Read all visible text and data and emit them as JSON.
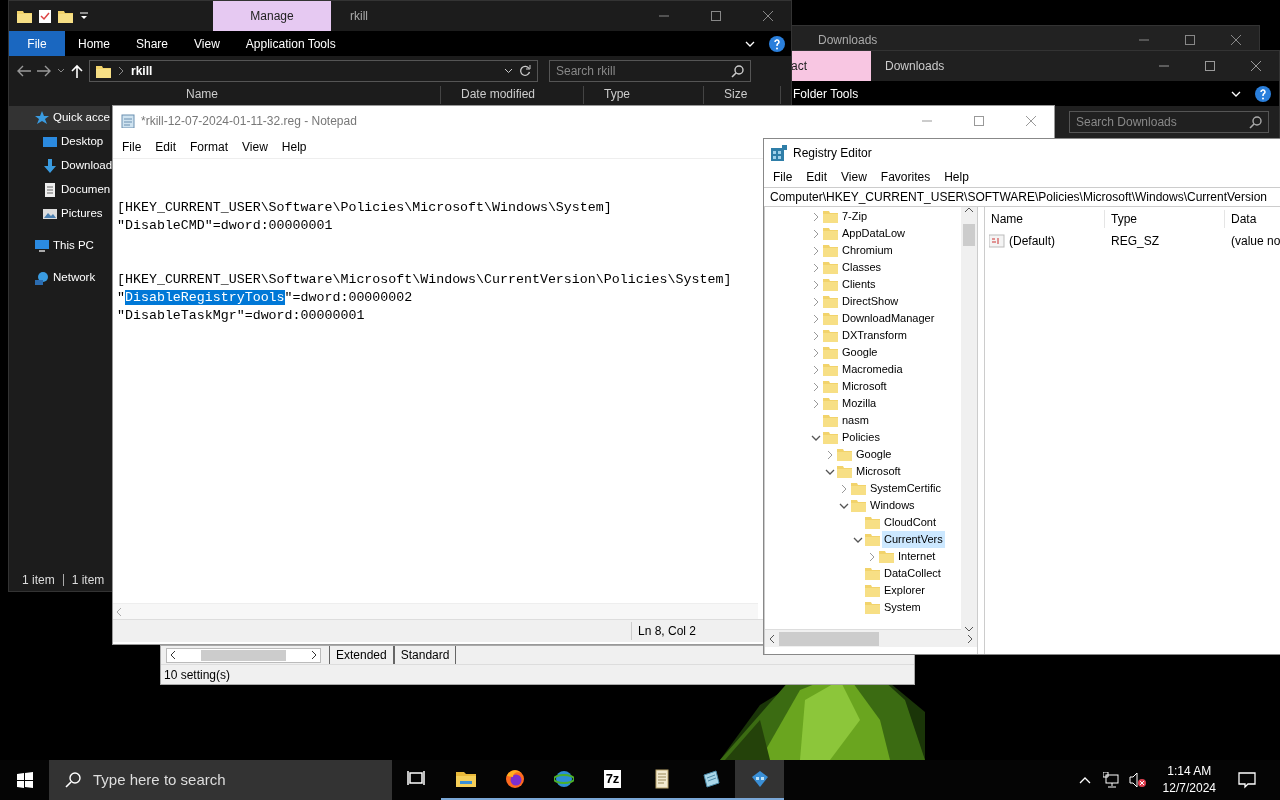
{
  "downloads_back": {
    "title": "Downloads"
  },
  "downloads_front": {
    "context_tab": "act",
    "title": "Downloads",
    "ribbon_tab": "Folder Tools",
    "search": {
      "placeholder": "Search Downloads"
    }
  },
  "settings_window": {
    "tabs": [
      "Extended",
      "Standard"
    ],
    "status": "10 setting(s)"
  },
  "explorer": {
    "context_tab": "Manage",
    "title": "rkill",
    "ribbon_tabs": [
      {
        "label": "File",
        "kind": "menu"
      },
      {
        "label": "Home",
        "kind": "tab"
      },
      {
        "label": "Share",
        "kind": "tab"
      },
      {
        "label": "View",
        "kind": "tab"
      },
      {
        "label": "Application Tools",
        "kind": "tab"
      }
    ],
    "address": "rkill",
    "search": {
      "placeholder": "Search rkill"
    },
    "columns": [
      "Name",
      "Date modified",
      "Type",
      "Size"
    ],
    "nav": [
      {
        "label": "Quick acce",
        "kind": "star",
        "selected": true,
        "children": [
          {
            "label": "Desktop",
            "kind": "desktop",
            "selected": false
          },
          {
            "label": "Download",
            "kind": "downloads",
            "selected": false
          },
          {
            "label": "Documen",
            "kind": "document",
            "selected": false
          },
          {
            "label": "Pictures",
            "kind": "pictures",
            "selected": false
          }
        ]
      },
      {
        "label": "This PC",
        "kind": "pc",
        "selected": false
      },
      {
        "label": "Network",
        "kind": "network",
        "selected": false
      }
    ],
    "status": [
      "1 item",
      "1 item"
    ]
  },
  "notepad": {
    "title": "*rkill-12-07-2024-01-11-32.reg - Notepad",
    "menu": [
      "File",
      "Edit",
      "Format",
      "View",
      "Help"
    ],
    "blocks": [
      {
        "lines": [
          {
            "segments": [
              {
                "text": "[HKEY_CURRENT_USER\\Software\\Policies\\Microsoft\\Windows\\System]",
                "selected": false
              }
            ]
          },
          {
            "segments": [
              {
                "text": "\"DisableCMD\"=dword:00000001",
                "selected": false
              }
            ]
          }
        ]
      },
      {
        "lines": [
          {
            "segments": [
              {
                "text": "[HKEY_CURRENT_USER\\Software\\Microsoft\\Windows\\CurrentVersion\\Policies\\System]",
                "selected": false
              }
            ]
          },
          {
            "segments": [
              {
                "text": "\"",
                "selected": false
              },
              {
                "text": "DisableRegistryTools",
                "selected": true
              },
              {
                "text": "\"=dword:00000002",
                "selected": false
              }
            ]
          },
          {
            "segments": [
              {
                "text": "\"DisableTaskMgr\"=dword:00000001",
                "selected": false
              }
            ]
          }
        ]
      }
    ],
    "status": "Ln 8, Col 2"
  },
  "regedit": {
    "title": "Registry Editor",
    "menu": [
      "File",
      "Edit",
      "View",
      "Favorites",
      "Help"
    ],
    "address": "Computer\\HKEY_CURRENT_USER\\SOFTWARE\\Policies\\Microsoft\\Windows\\CurrentVersion",
    "tree": [
      {
        "label": "7-Zip",
        "kind": "node",
        "expanded": false,
        "selected": false
      },
      {
        "label": "AppDataLow",
        "kind": "node",
        "expanded": false,
        "selected": false
      },
      {
        "label": "Chromium",
        "kind": "node",
        "expanded": false,
        "selected": false
      },
      {
        "label": "Classes",
        "kind": "node",
        "expanded": false,
        "selected": false
      },
      {
        "label": "Clients",
        "kind": "node",
        "expanded": false,
        "selected": false
      },
      {
        "label": "DirectShow",
        "kind": "node",
        "expanded": false,
        "selected": false
      },
      {
        "label": "DownloadManager",
        "kind": "node",
        "expanded": false,
        "selected": false
      },
      {
        "label": "DXTransform",
        "kind": "node",
        "expanded": false,
        "selected": false
      },
      {
        "label": "Google",
        "kind": "node",
        "expanded": false,
        "selected": false
      },
      {
        "label": "Macromedia",
        "kind": "node",
        "expanded": false,
        "selected": false
      },
      {
        "label": "Microsoft",
        "kind": "node",
        "expanded": false,
        "selected": false
      },
      {
        "label": "Mozilla",
        "kind": "node",
        "expanded": false,
        "selected": false
      },
      {
        "label": "nasm",
        "kind": "leaf",
        "selected": false
      },
      {
        "label": "Policies",
        "kind": "node",
        "expanded": true,
        "selected": false,
        "children": [
          {
            "label": "Google",
            "kind": "node",
            "expanded": false,
            "selected": false
          },
          {
            "label": "Microsoft",
            "kind": "node",
            "expanded": true,
            "selected": false,
            "children": [
              {
                "label": "SystemCertific",
                "kind": "node",
                "expanded": false,
                "selected": false
              },
              {
                "label": "Windows",
                "kind": "node",
                "expanded": true,
                "selected": false,
                "children": [
                  {
                    "label": "CloudCont",
                    "kind": "leaf",
                    "selected": false
                  },
                  {
                    "label": "CurrentVers",
                    "kind": "node",
                    "expanded": true,
                    "selected": true,
                    "children": [
                      {
                        "label": "Internet",
                        "kind": "node",
                        "expanded": false,
                        "selected": false
                      }
                    ]
                  },
                  {
                    "label": "DataCollect",
                    "kind": "leaf",
                    "selected": false
                  },
                  {
                    "label": "Explorer",
                    "kind": "leaf",
                    "selected": false
                  },
                  {
                    "label": "System",
                    "kind": "leaf",
                    "selected": false
                  }
                ]
              }
            ]
          }
        ]
      }
    ],
    "columns": [
      "Name",
      "Type",
      "Data"
    ],
    "values": [
      {
        "name": "(Default)",
        "type": "REG_SZ",
        "data": "(value no"
      }
    ]
  },
  "taskbar": {
    "search": {
      "placeholder": "Type here to search"
    },
    "apps": [
      {
        "kind": "task_view",
        "running": false,
        "selected": false
      },
      {
        "kind": "explorer",
        "running": true,
        "selected": false
      },
      {
        "kind": "firefox",
        "running": true,
        "selected": false
      },
      {
        "kind": "browser",
        "running": true,
        "selected": false
      },
      {
        "kind": "archiver",
        "label": "7z",
        "running": true,
        "selected": false
      },
      {
        "kind": "notepad",
        "running": true,
        "selected": false
      },
      {
        "kind": "editor",
        "running": true,
        "selected": false
      },
      {
        "kind": "regedit",
        "running": true,
        "selected": true
      }
    ],
    "tray": {
      "muted": true
    },
    "clock": {
      "time": "1:14 AM",
      "date": "12/7/2024"
    }
  }
}
